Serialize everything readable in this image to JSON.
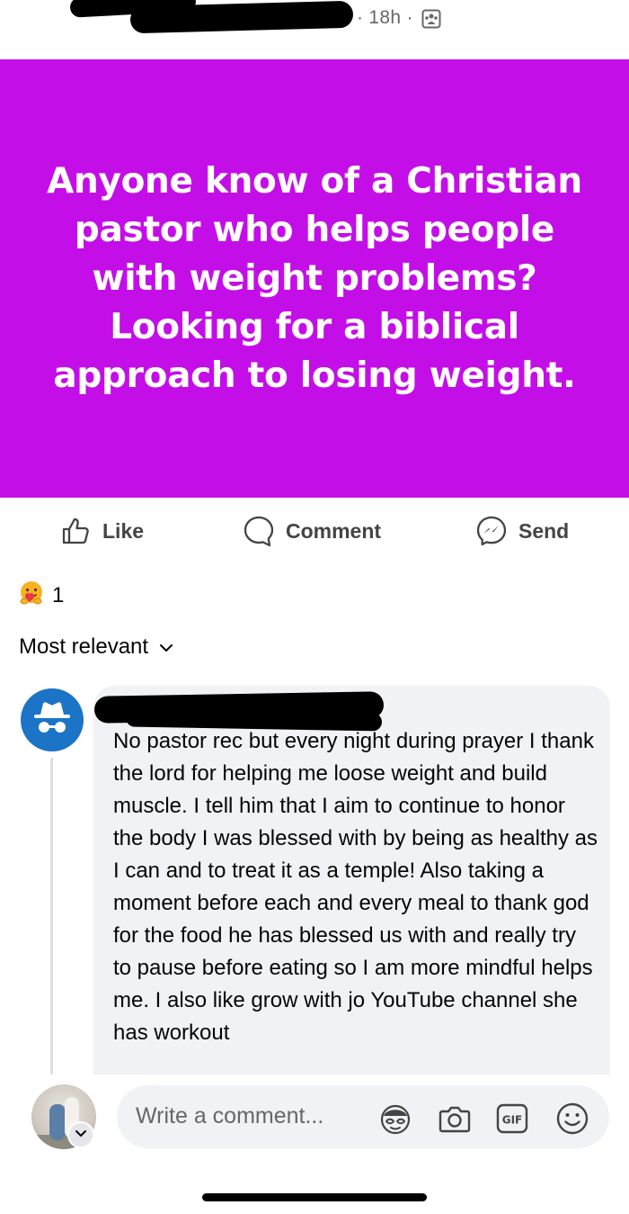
{
  "post": {
    "meta_text": "· 18h ·",
    "privacy_icon": "group-privacy-icon",
    "background_color": "#c40ee8",
    "text": "Anyone know of a Christian pastor who helps people with weight problems? Looking for a biblical approach to losing weight."
  },
  "actions": {
    "like_label": "Like",
    "comment_label": "Comment",
    "send_label": "Send"
  },
  "reactions": {
    "emoji_icon": "care-reaction-icon",
    "count": "1"
  },
  "sort": {
    "label": "Most relevant"
  },
  "comment": {
    "avatar_icon": "anonymous-incognito-icon",
    "text": "No pastor rec but every night during prayer I thank the lord for helping me loose weight and build muscle. I tell him that I aim to continue to honor the body I was blessed with by being as healthy as I can and to treat it as a temple! Also taking a moment before each and every meal to thank god for the food he has blessed us with and really try to pause before eating so I am more mindful helps me. I also like grow with jo YouTube channel she has workout"
  },
  "composer": {
    "placeholder": "Write a comment...",
    "icons": [
      "avatar-sticker-icon",
      "camera-icon",
      "gif-icon",
      "emoji-icon"
    ]
  }
}
